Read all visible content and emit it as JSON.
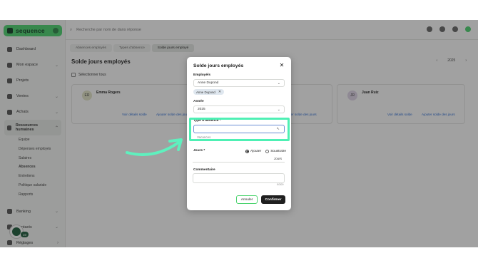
{
  "app": {
    "brand": "sequence"
  },
  "topbar": {
    "search_placeholder": "Recherche par nom de dans réponse"
  },
  "sidebar": {
    "items": [
      {
        "label": "Dashboard",
        "chevron": false
      },
      {
        "label": "Mon espace",
        "chevron": true
      },
      {
        "label": "Projets",
        "chevron": false
      },
      {
        "label": "Ventes",
        "chevron": true
      },
      {
        "label": "Achats",
        "chevron": true
      },
      {
        "label": "Ressources humaines",
        "chevron": true,
        "active": true
      }
    ],
    "subitems": [
      "Equipe",
      "Dépenses employés",
      "Salaires",
      "Absences",
      "Entretiens",
      "Politique salariale",
      "Rapports"
    ],
    "active_subitem": "Absences",
    "bottom_items": [
      {
        "label": "Banking"
      },
      {
        "label": "Contacts"
      },
      {
        "label": "Réglages"
      }
    ],
    "help_badge": "10"
  },
  "content": {
    "tabs": [
      "Absences employés",
      "Types d'absence",
      "Solde jours employé"
    ],
    "active_tab": "Solde jours employé",
    "page_title": "Solde jours employés",
    "select_all": "Sélectionner tous",
    "year": "2025",
    "employees": [
      {
        "initials": "ER",
        "name": "Emma Rogers",
        "link1": "Voir détails solde",
        "link2": "Ajouter solde des jours"
      },
      {
        "initials": "",
        "name": "",
        "link1": "",
        "link2": "Ajouter solde des jours"
      },
      {
        "initials": "JR",
        "name": "Juan Ruiz",
        "link1": "Voir détails solde",
        "link2": "Ajouter solde des jours"
      }
    ]
  },
  "modal": {
    "title": "Solde jours employés",
    "employees_label": "Employé/s",
    "employees_value": "Anne Dupond",
    "employee_chip": "Anne Dupond",
    "year_label": "Année",
    "year_value": "2025",
    "absence_type_label": "Type d'absence *",
    "absence_type_value": "",
    "dropdown_hint": "Vacances",
    "days_label": "Jours *",
    "radio_add": "Ajouter",
    "radio_subtract": "Soustraire",
    "radio_selected": "Ajouter",
    "days_unit": "Jours",
    "comment_label": "Commentaire",
    "comment_counter": "0/300",
    "cancel_label": "Annuler",
    "confirm_label": "Confirmer"
  },
  "colors": {
    "brand_green": "#4bd46e",
    "highlight": "#4ef0b4",
    "arrow": "#5ff0be",
    "confirm_bg": "#1f1f1f"
  }
}
